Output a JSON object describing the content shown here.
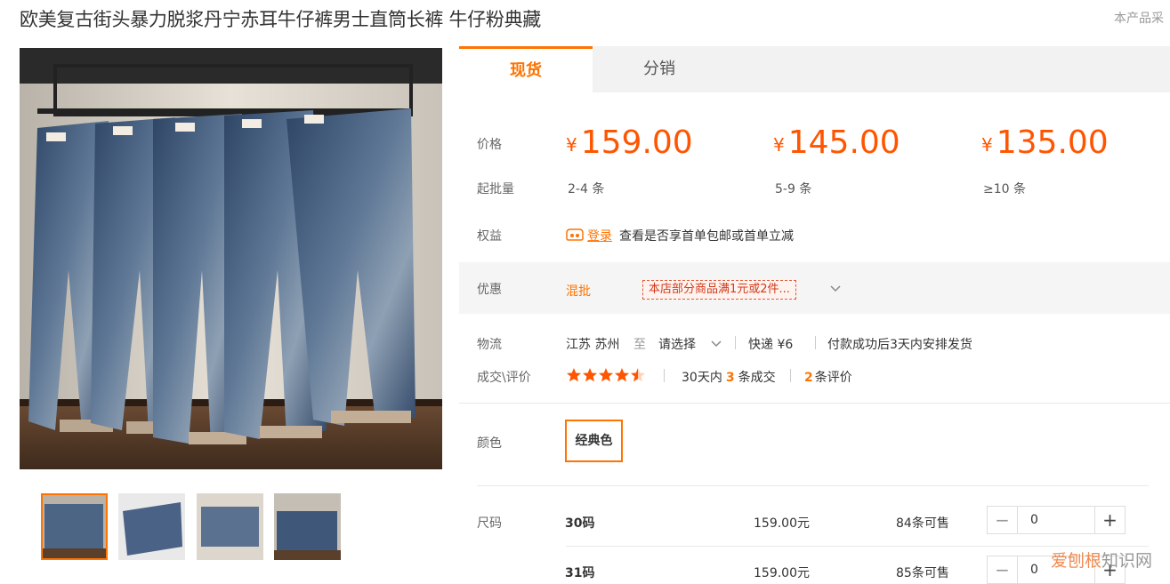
{
  "product": {
    "title": "欧美复古街头暴力脱浆丹宁赤耳牛仔裤男士直筒长裤 牛仔粉典藏",
    "top_note": "本产品采"
  },
  "tabs": [
    {
      "label": "现货",
      "active": true
    },
    {
      "label": "分销",
      "active": false
    }
  ],
  "price_section": {
    "price_label": "价格",
    "moq_label": "起批量",
    "currency": "¥",
    "tiers": [
      {
        "price": "159.00",
        "qty": "2-4 条"
      },
      {
        "price": "145.00",
        "qty": "5-9 条"
      },
      {
        "price": "135.00",
        "qty": "≥10 条"
      }
    ]
  },
  "benefit": {
    "label": "权益",
    "login_link": "登录",
    "text": "查看是否享首单包邮或首单立减"
  },
  "promo": {
    "label": "优惠",
    "mix_link": "混批",
    "tag": "本店部分商品满1元或2件..."
  },
  "logistics": {
    "label": "物流",
    "origin": "江苏 苏州",
    "to": "至",
    "dest_select": "请选择",
    "shipping": "快递 ¥6",
    "dispatch": "付款成功后3天内安排发货"
  },
  "reviews": {
    "label": "成交\\评价",
    "rating": 4.5,
    "sales_prefix": "30天内",
    "sales_count": "3",
    "sales_suffix": "条成交",
    "review_count": "2",
    "review_suffix": "条评价"
  },
  "color": {
    "label": "颜色",
    "options": [
      "经典色"
    ],
    "selected": "经典色"
  },
  "size": {
    "label": "尺码",
    "rows": [
      {
        "size": "30码",
        "price": "159.00元",
        "stock": "84条可售",
        "qty": "0"
      },
      {
        "size": "31码",
        "price": "159.00元",
        "stock": "85条可售",
        "qty": "0"
      }
    ]
  },
  "watermark": {
    "brand": "爱刨根",
    "suffix": "知识网"
  },
  "colors": {
    "accent": "#ff7300",
    "price": "#ff5500"
  }
}
